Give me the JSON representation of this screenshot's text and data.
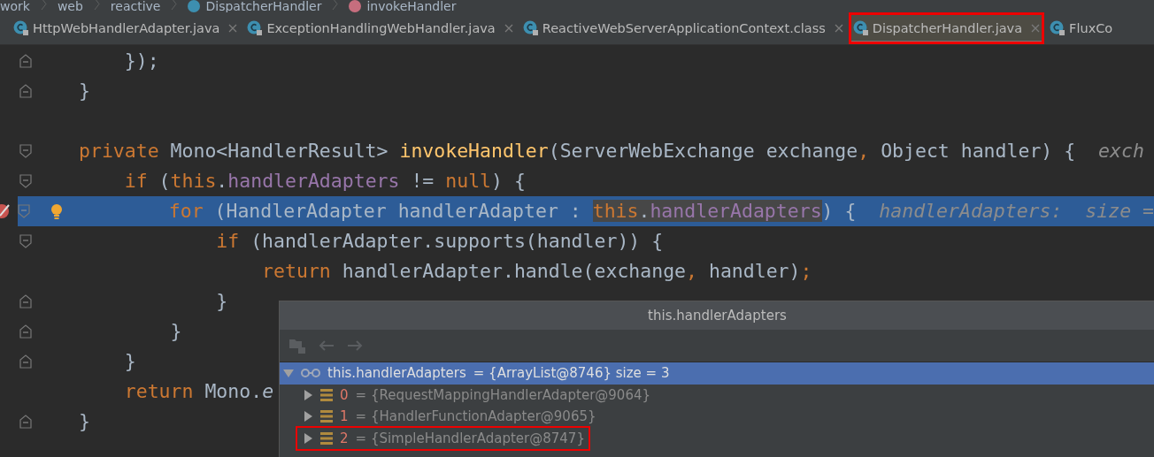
{
  "breadcrumbs": [
    {
      "label": "work",
      "kind": "package"
    },
    {
      "label": "web",
      "kind": "package"
    },
    {
      "label": "reactive",
      "kind": "package"
    },
    {
      "label": "DispatcherHandler",
      "kind": "class"
    },
    {
      "label": "invokeHandler",
      "kind": "method"
    }
  ],
  "tabs": [
    {
      "label": "HttpWebHandlerAdapter.java",
      "selected": false,
      "annotated": false,
      "closable": true
    },
    {
      "label": "ExceptionHandlingWebHandler.java",
      "selected": false,
      "annotated": false,
      "closable": true
    },
    {
      "label": "ReactiveWebServerApplicationContext.class",
      "selected": false,
      "annotated": false,
      "closable": true
    },
    {
      "label": "DispatcherHandler.java",
      "selected": true,
      "annotated": true,
      "closable": true
    },
    {
      "label": "FluxCo",
      "selected": false,
      "annotated": false,
      "closable": false
    }
  ],
  "code_lines": [
    {
      "kind": "block_end",
      "current": false,
      "breakpoint": false,
      "intention": false,
      "tokens": [
        {
          "text": "    });",
          "kind": "plain"
        }
      ]
    },
    {
      "kind": "block_end",
      "current": false,
      "breakpoint": false,
      "intention": false,
      "tokens": [
        {
          "text": "}",
          "kind": "plain"
        }
      ]
    },
    {
      "kind": "plain",
      "current": false,
      "breakpoint": false,
      "intention": false
    },
    {
      "kind": "block_start",
      "current": false,
      "breakpoint": false,
      "intention": false,
      "tokens": [
        {
          "text": "private ",
          "kind": "keyword"
        },
        {
          "text": "Mono<HandlerResult> ",
          "kind": "plain"
        },
        {
          "text": "invokeHandler",
          "kind": "method"
        },
        {
          "text": "(ServerWebExchange exchange",
          "kind": "plain"
        },
        {
          "text": ", ",
          "kind": "keyword"
        },
        {
          "text": "Object handler) {  ",
          "kind": "plain"
        },
        {
          "text": "exch",
          "kind": "hint"
        }
      ]
    },
    {
      "kind": "block_start",
      "current": false,
      "breakpoint": false,
      "intention": false,
      "tokens": [
        {
          "text": "    if ",
          "kind": "keyword"
        },
        {
          "text": "(",
          "kind": "plain"
        },
        {
          "text": "this",
          "kind": "keyword"
        },
        {
          "text": ".",
          "kind": "plain"
        },
        {
          "text": "handlerAdapters",
          "kind": "field"
        },
        {
          "text": " != ",
          "kind": "plain"
        },
        {
          "text": "null",
          "kind": "keyword"
        },
        {
          "text": ") {",
          "kind": "plain"
        }
      ]
    },
    {
      "kind": "block_start",
      "current": true,
      "breakpoint": true,
      "intention": true,
      "tokens": [
        {
          "text": "        for ",
          "kind": "keyword",
          "highlighted": false
        },
        {
          "text": "(HandlerAdapter handlerAdapter : ",
          "kind": "plain",
          "highlighted": false
        },
        {
          "text": "this",
          "kind": "keyword",
          "highlighted": true
        },
        {
          "text": ".",
          "kind": "plain",
          "highlighted": true
        },
        {
          "text": "handlerAdapters",
          "kind": "field",
          "highlighted": true
        },
        {
          "text": ") {  ",
          "kind": "plain",
          "highlighted": false
        },
        {
          "text": "handlerAdapters:  size =",
          "kind": "hint",
          "highlighted": false
        }
      ]
    },
    {
      "kind": "block_start",
      "current": false,
      "breakpoint": false,
      "intention": false,
      "tokens": [
        {
          "text": "            if ",
          "kind": "keyword"
        },
        {
          "text": "(handlerAdapter.supports(handler)) {",
          "kind": "plain"
        }
      ]
    },
    {
      "kind": "plain",
      "current": false,
      "breakpoint": false,
      "intention": false,
      "tokens": [
        {
          "text": "                return ",
          "kind": "keyword"
        },
        {
          "text": "handlerAdapter.handle(exchange",
          "kind": "plain"
        },
        {
          "text": ", ",
          "kind": "keyword"
        },
        {
          "text": "handler)",
          "kind": "plain"
        },
        {
          "text": ";",
          "kind": "keyword"
        }
      ]
    },
    {
      "kind": "block_end",
      "current": false,
      "breakpoint": false,
      "intention": false,
      "tokens": [
        {
          "text": "            }",
          "kind": "plain"
        }
      ]
    },
    {
      "kind": "block_end",
      "current": false,
      "breakpoint": false,
      "intention": false,
      "tokens": [
        {
          "text": "        }",
          "kind": "plain"
        }
      ]
    },
    {
      "kind": "block_end",
      "current": false,
      "breakpoint": false,
      "intention": false,
      "tokens": [
        {
          "text": "    }",
          "kind": "plain"
        }
      ]
    },
    {
      "kind": "plain",
      "current": false,
      "breakpoint": false,
      "intention": false,
      "tokens": [
        {
          "text": "    return ",
          "kind": "keyword"
        },
        {
          "text": "Mono.",
          "kind": "plain"
        },
        {
          "text": "e",
          "kind": "static"
        }
      ]
    },
    {
      "kind": "block_end",
      "current": false,
      "breakpoint": false,
      "intention": false,
      "tokens": [
        {
          "text": "}",
          "kind": "plain"
        }
      ]
    }
  ],
  "popup": {
    "title": "this.handlerAdapters",
    "toolbar": [
      {
        "kind": "inspect",
        "disabled": true
      },
      {
        "kind": "back",
        "disabled": true
      },
      {
        "kind": "forward",
        "disabled": true
      }
    ],
    "root": {
      "name": "this.handlerAdapters",
      "value": "= {ArrayList@8746}  size = 3",
      "expanded": true,
      "selected": true
    },
    "items": [
      {
        "index": "0",
        "value": "= {RequestMappingHandlerAdapter@9064}",
        "expanded": false,
        "selected": false,
        "annotated": false
      },
      {
        "index": "1",
        "value": "= {HandlerFunctionAdapter@9065}",
        "expanded": false,
        "selected": false,
        "annotated": false
      },
      {
        "index": "2",
        "value": "= {SimpleHandlerAdapter@8747}",
        "expanded": false,
        "selected": false,
        "annotated": true
      }
    ]
  }
}
